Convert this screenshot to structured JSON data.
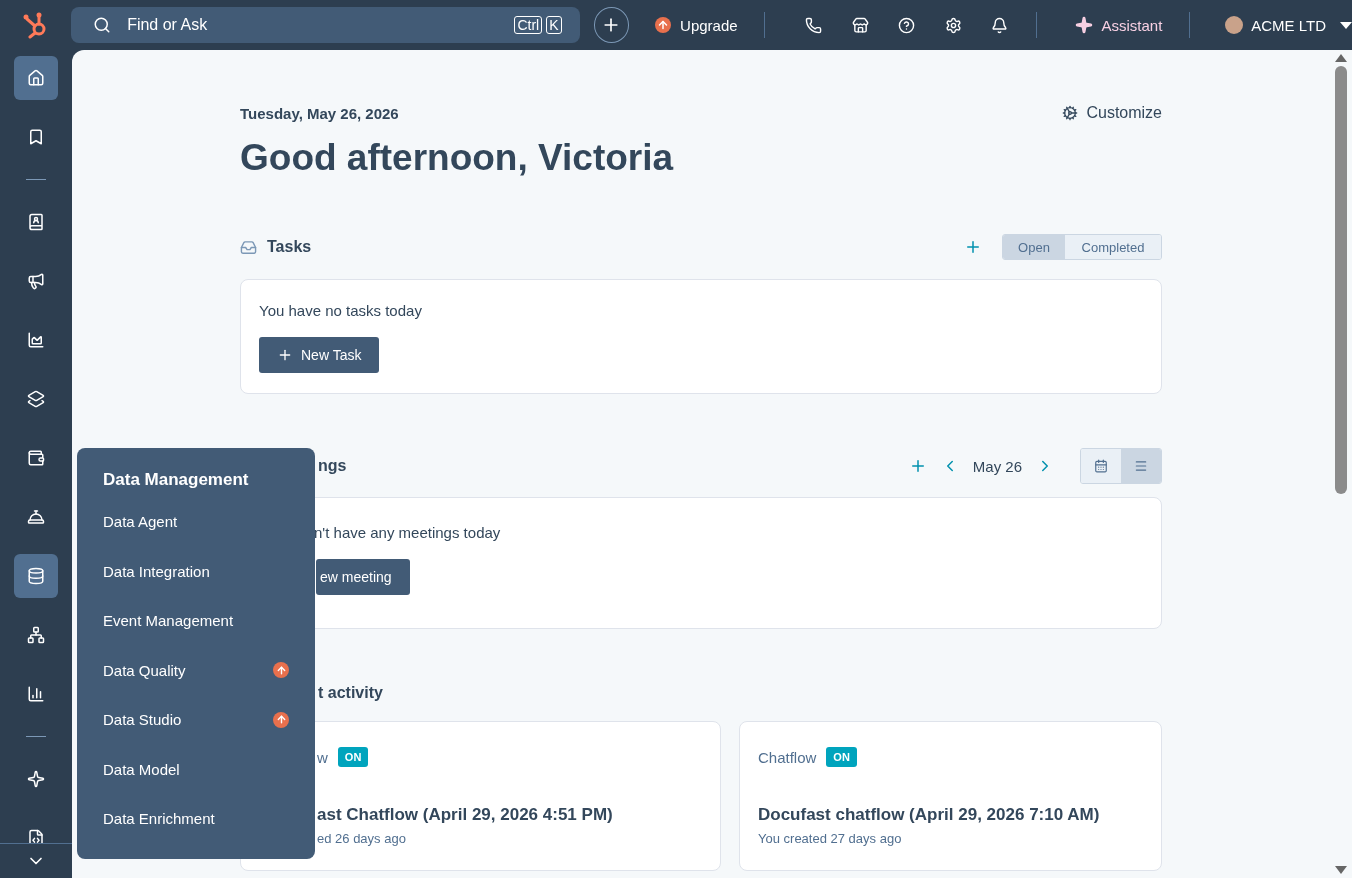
{
  "topbar": {
    "search": {
      "placeholder": "Find or Ask",
      "shortcut": [
        "Ctrl",
        "K"
      ]
    },
    "upgrade": "Upgrade",
    "assistant": "Assistant",
    "account": "ACME LTD"
  },
  "sidebar": {
    "items": [
      {
        "kind": "home",
        "selected": true
      },
      {
        "kind": "bookmark",
        "selected": false
      },
      {
        "kind": "divider"
      },
      {
        "kind": "contacts",
        "selected": false
      },
      {
        "kind": "marketing",
        "selected": false
      },
      {
        "kind": "reports",
        "selected": false
      },
      {
        "kind": "commerce",
        "selected": false
      },
      {
        "kind": "wallet",
        "selected": false
      },
      {
        "kind": "service",
        "selected": false
      },
      {
        "kind": "data",
        "selected": true
      },
      {
        "kind": "hierarchy",
        "selected": false
      },
      {
        "kind": "analytics",
        "selected": false
      },
      {
        "kind": "divider"
      },
      {
        "kind": "ai",
        "selected": false
      },
      {
        "kind": "code",
        "selected": false
      }
    ]
  },
  "page": {
    "date": "Tuesday, May 26, 2026",
    "greeting": "Good afternoon, Victoria",
    "customize": "Customize"
  },
  "tasks": {
    "title": "Tasks",
    "filters": [
      {
        "label": "Open",
        "selected": true
      },
      {
        "label": "Completed",
        "selected": false
      }
    ],
    "empty": "You have no tasks today",
    "button": "New Task"
  },
  "meetings": {
    "title": "ngs",
    "date": "May 26",
    "views": [
      {
        "kind": "calendar",
        "selected": false
      },
      {
        "kind": "list",
        "selected": true
      }
    ],
    "empty": "n't have any meetings today",
    "button": "ew meeting"
  },
  "activity": {
    "title": "t activity",
    "cards": [
      {
        "type": "w",
        "status": "ON",
        "name": "ast Chatflow (April 29, 2026 4:51 PM)",
        "meta": "ed 26 days ago"
      },
      {
        "type": "Chatflow",
        "status": "ON",
        "name": "Docufast chatflow (April 29, 2026 7:10 AM)",
        "meta": "You created 27 days ago"
      }
    ]
  },
  "menu": {
    "title": "Data Management",
    "items": [
      {
        "label": "Data Agent",
        "upgrade": false
      },
      {
        "label": "Data Integration",
        "upgrade": false
      },
      {
        "label": "Event Management",
        "upgrade": false
      },
      {
        "label": "Data Quality",
        "upgrade": true
      },
      {
        "label": "Data Studio",
        "upgrade": true
      },
      {
        "label": "Data Model",
        "upgrade": false
      },
      {
        "label": "Data Enrichment",
        "upgrade": false
      }
    ]
  }
}
